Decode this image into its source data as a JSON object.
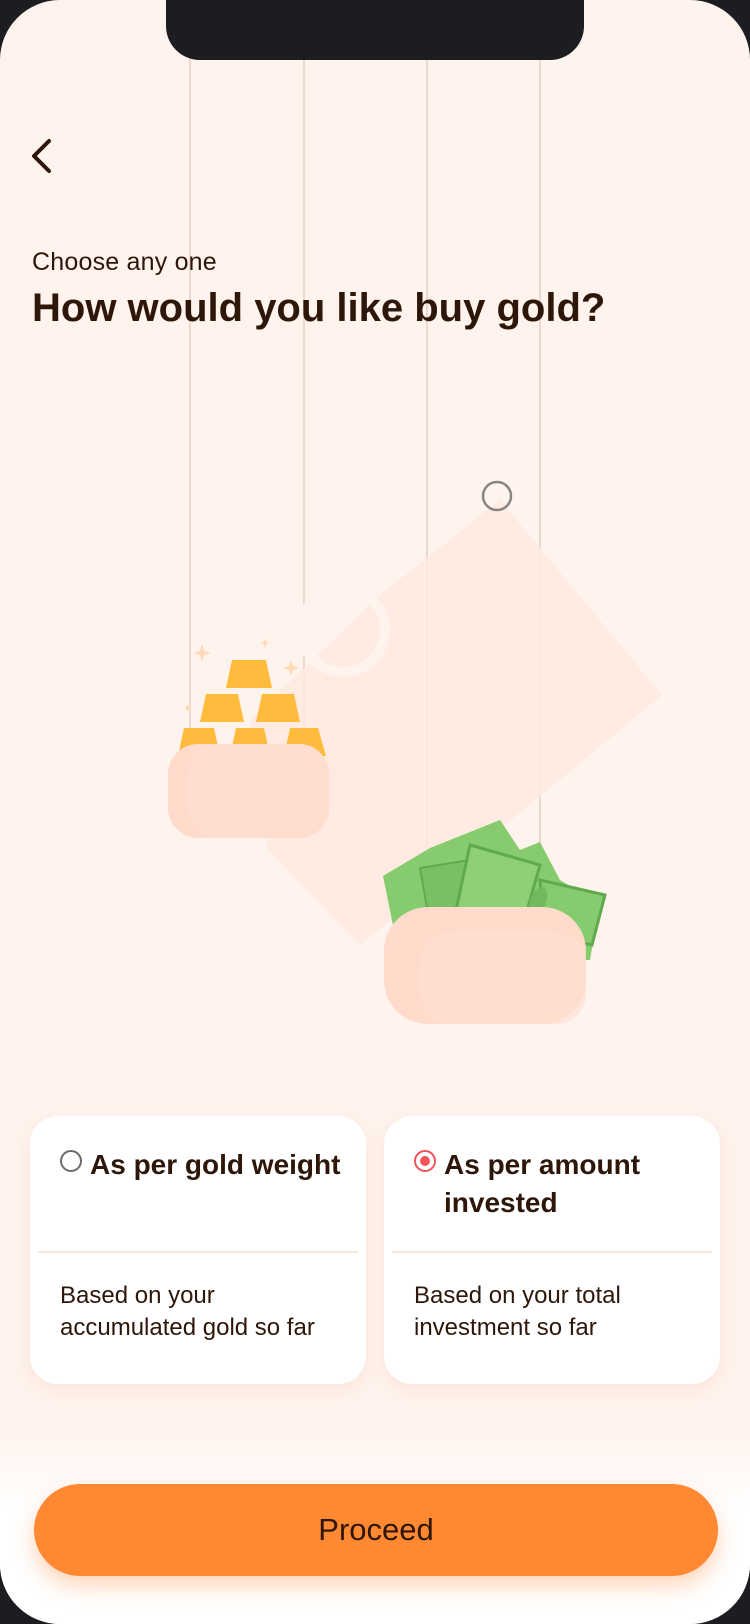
{
  "header": {
    "back_icon": "chevron-left-icon",
    "subtitle": "Choose any one",
    "title": "How would you like buy gold?"
  },
  "options": [
    {
      "title": "As per gold weight",
      "description": "Based on your accumulated gold so far",
      "selected": false
    },
    {
      "title": "As per amount invested",
      "description": "Based on your total investment so far",
      "selected": true
    }
  ],
  "illustration": {
    "left_item_icon": "gold-bars-icon",
    "right_item_icon": "cash-stack-icon"
  },
  "footer": {
    "proceed_label": "Proceed"
  },
  "colors": {
    "background": "#fff3ed",
    "text": "#2e1609",
    "accent": "#ff8833",
    "radio_selected": "#f0545a"
  }
}
